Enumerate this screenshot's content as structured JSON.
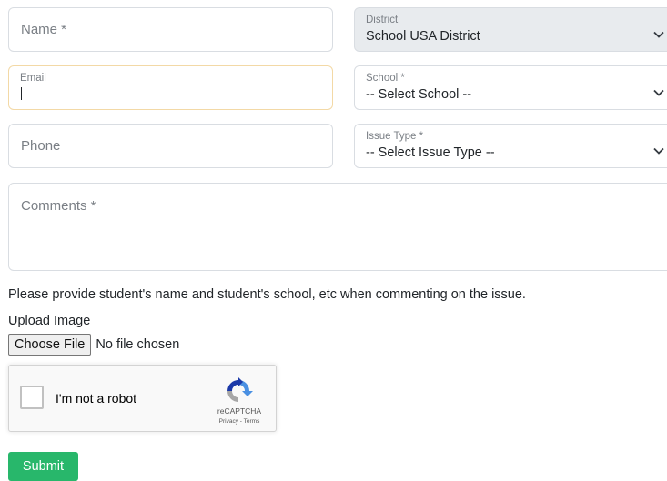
{
  "form": {
    "name_placeholder": "Name *",
    "email_label": "Email",
    "email_value": "",
    "phone_placeholder": "Phone",
    "district": {
      "label": "District",
      "value": "School USA District"
    },
    "school": {
      "label": "School *",
      "value": "-- Select School --"
    },
    "issue_type": {
      "label": "Issue Type *",
      "value": "-- Select Issue Type --"
    },
    "comments_placeholder": "Comments *",
    "help_text": "Please provide student's name and student's school, etc when commenting on the issue.",
    "upload": {
      "label": "Upload Image",
      "button": "Choose File",
      "status": "No file chosen"
    },
    "captcha": {
      "text": "I'm not a robot",
      "brand": "reCAPTCHA",
      "privacy": "Privacy",
      "separator": " - ",
      "terms": "Terms"
    },
    "submit_label": "Submit"
  },
  "colors": {
    "submit": "#28b76b",
    "focus_border": "#f3d9a6",
    "disabled_bg": "#e8ebee"
  },
  "icons": {
    "select": "chevron-down-icon",
    "captcha": "recaptcha-logo-icon"
  }
}
